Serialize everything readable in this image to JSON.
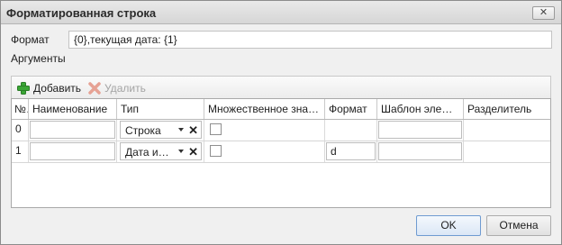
{
  "window": {
    "title": "Форматированная строка",
    "close_glyph": "✕"
  },
  "format": {
    "label": "Формат",
    "value": "{0},текущая дата: {1}"
  },
  "arguments": {
    "label": "Аргументы"
  },
  "toolbar": {
    "add_label": "Добавить",
    "delete_label": "Удалить"
  },
  "table": {
    "columns": [
      "№",
      "Наименование",
      "Тип",
      "Множественное зна…",
      "Формат",
      "Шаблон элем…",
      "Разделитель"
    ],
    "rows": [
      {
        "index": "0",
        "name": "",
        "type": "Строка",
        "multiple": false,
        "format": "",
        "template": "",
        "separator": ""
      },
      {
        "index": "1",
        "name": "",
        "type": "Дата и…",
        "multiple": false,
        "format": "d",
        "template": "",
        "separator": ""
      }
    ]
  },
  "buttons": {
    "ok": "OK",
    "cancel": "Отмена"
  },
  "icons": {
    "add": "plus-icon",
    "delete": "delete-x-icon",
    "clear": "clear-x-icon",
    "dropdown": "chevron-down-icon"
  },
  "colors": {
    "add_icon": "#3aa635",
    "delete_icon": "#e08a7a",
    "accent_border": "#6f9bd1"
  }
}
